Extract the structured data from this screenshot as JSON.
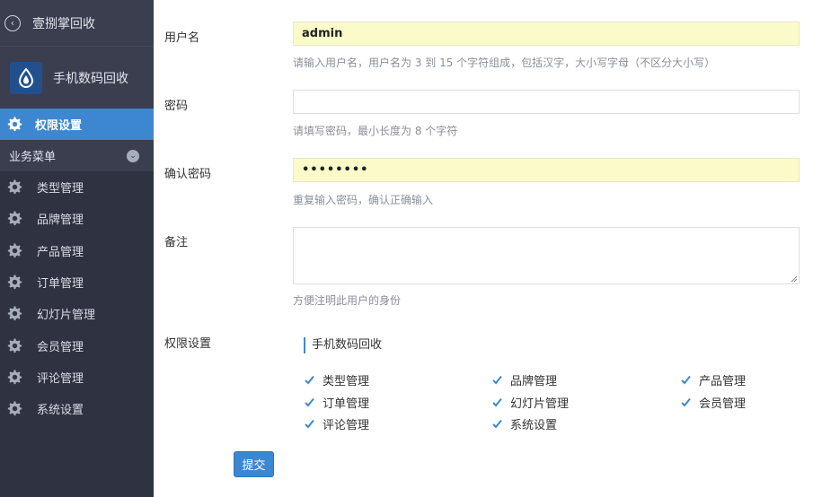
{
  "sidebar": {
    "back_title": "壹捌掌回收",
    "app_name": "手机数码回收",
    "active_item": "权限设置",
    "section_title": "业务菜单",
    "items": [
      "类型管理",
      "品牌管理",
      "产品管理",
      "订单管理",
      "幻灯片管理",
      "会员管理",
      "评论管理",
      "系统设置"
    ]
  },
  "form": {
    "username_label": "用户名",
    "username_value": "admin",
    "username_hint": "请输入用户名，用户名为 3 到 15 个字符组成，包括汉字，大小写字母（不区分大小写）",
    "password_label": "密码",
    "password_value": "",
    "password_hint": "请填写密码，最小长度为 8 个字符",
    "confirm_label": "确认密码",
    "confirm_value": "••••••••",
    "confirm_hint": "重复输入密码，确认正确输入",
    "remark_label": "备注",
    "remark_hint": "方便注明此用户的身份",
    "perm_label": "权限设置",
    "perm_group_title": "手机数码回收",
    "perms": [
      {
        "label": "类型管理",
        "checked": true
      },
      {
        "label": "品牌管理",
        "checked": true
      },
      {
        "label": "产品管理",
        "checked": true
      },
      {
        "label": "订单管理",
        "checked": true
      },
      {
        "label": "幻灯片管理",
        "checked": true
      },
      {
        "label": "会员管理",
        "checked": true
      },
      {
        "label": "评论管理",
        "checked": true
      },
      {
        "label": "系统设置",
        "checked": true
      }
    ],
    "submit_label": "提交"
  },
  "colors": {
    "sidebar_bg": "#2f3240",
    "active_bg": "#3d87d1",
    "filled_input_bg": "#fafbc9",
    "accent": "#3d87d1"
  }
}
